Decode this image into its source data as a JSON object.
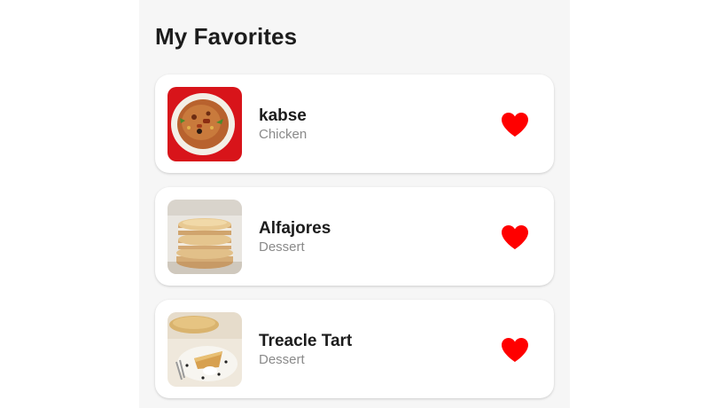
{
  "page": {
    "title": "My Favorites"
  },
  "favorites": [
    {
      "name": "kabse",
      "category": "Chicken",
      "favorited": true,
      "image_icon": "meal-image-kabse"
    },
    {
      "name": "Alfajores",
      "category": "Dessert",
      "favorited": true,
      "image_icon": "meal-image-alfajores"
    },
    {
      "name": "Treacle Tart",
      "category": "Dessert",
      "favorited": true,
      "image_icon": "meal-image-treacle-tart"
    }
  ],
  "colors": {
    "heart": "#ff0000",
    "background": "#f6f6f6",
    "card": "#ffffff",
    "subtitle": "#8a8a8a"
  }
}
